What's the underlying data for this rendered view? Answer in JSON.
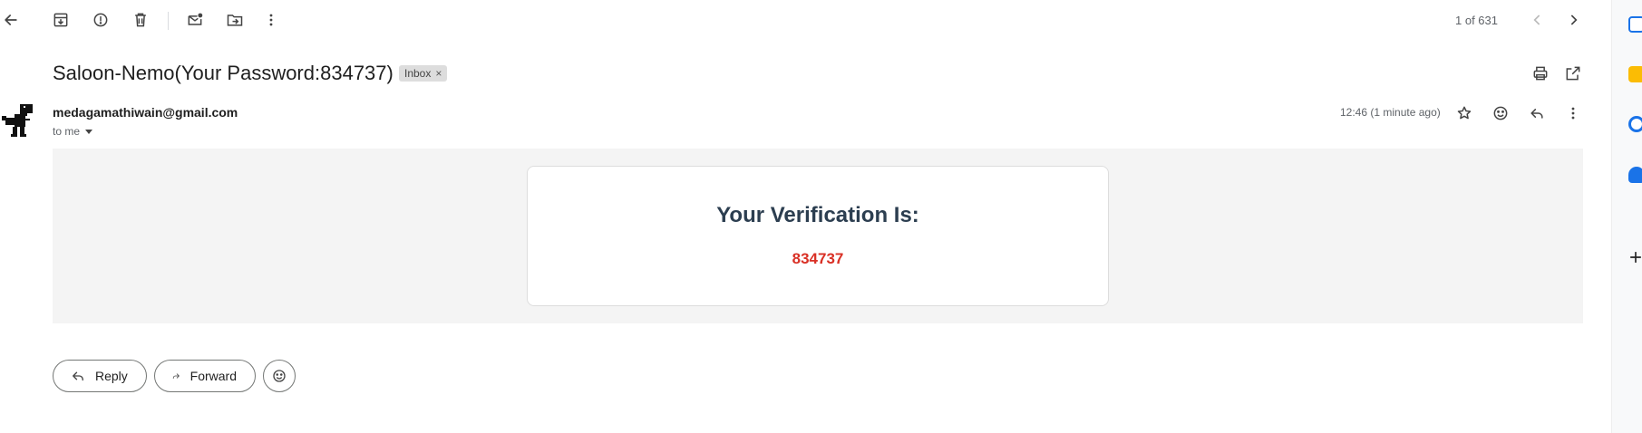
{
  "toolbar": {
    "pager_text": "1 of 631"
  },
  "message": {
    "subject": "Saloon-Nemo(Your Password:834737)",
    "label": "Inbox",
    "label_remove": "×",
    "sender": "medagamathiwain@gmail.com",
    "recipient": "to me",
    "timestamp": "12:46 (1 minute ago)"
  },
  "email_body": {
    "heading": "Your Verification Is:",
    "code": "834737"
  },
  "actions": {
    "reply_label": "Reply",
    "forward_label": "Forward"
  },
  "colors": {
    "code": "#d93025",
    "heading": "#2c3e50",
    "body_bg": "#f4f4f4"
  },
  "icons": [
    "back-arrow-icon",
    "archive-icon",
    "report-spam-icon",
    "delete-icon",
    "mark-unread-icon",
    "move-to-icon",
    "more-vert-icon",
    "chevron-left-icon",
    "chevron-right-icon",
    "print-icon",
    "open-new-window-icon",
    "star-icon",
    "emoji-icon",
    "reply-icon",
    "calendar-icon",
    "keep-icon",
    "tasks-icon",
    "contacts-icon",
    "add-icon"
  ]
}
